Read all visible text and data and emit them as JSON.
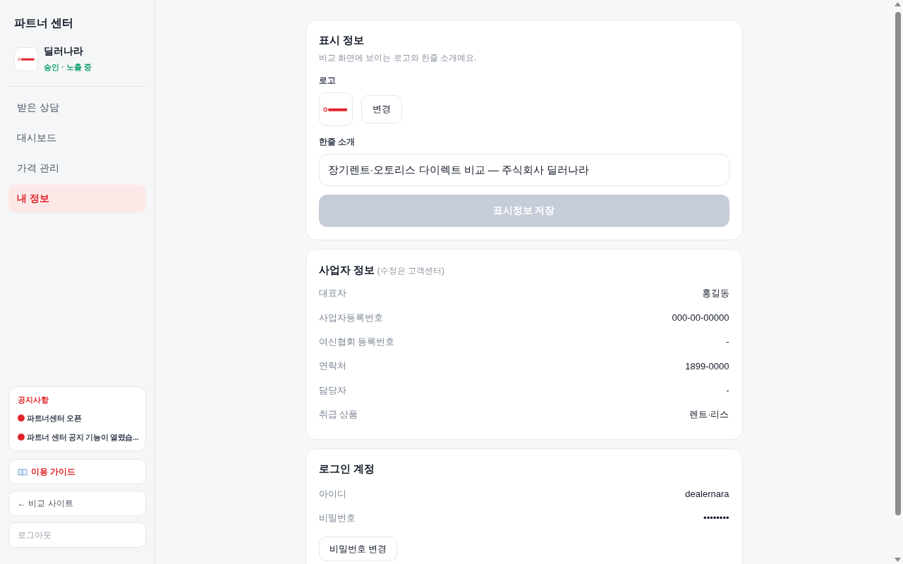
{
  "sidebar": {
    "title": "파트너 센터",
    "partner": {
      "name": "딜러나라",
      "status": "승인 · 노출 중"
    },
    "nav_items": [
      {
        "label": "받은 상담",
        "selected": false
      },
      {
        "label": "대시보드",
        "selected": false
      },
      {
        "label": "가격 관리",
        "selected": false
      },
      {
        "label": "내 정보",
        "selected": true
      }
    ],
    "notices": {
      "title": "공지사항",
      "items": [
        "파트너센터 오픈",
        "파트너 센터 공지 기능이 열렸습..."
      ]
    },
    "links": [
      {
        "kind": "guide",
        "label": "이용 가이드"
      },
      {
        "kind": "back",
        "label": "← 비교 사이트"
      },
      {
        "kind": "logout",
        "label": "로그아웃"
      }
    ]
  },
  "display_info": {
    "title": "표시 정보",
    "description": "비교 화면에 보이는 로고와 한줄 소개예요.",
    "logo_label": "로고",
    "change_button": "변경",
    "tagline_label": "한줄 소개",
    "tagline_value": "장기렌트·오토리스 다이렉트 비교 — 주식회사 딜러나라",
    "save_button": {
      "label": "표시정보 저장",
      "disabled": true
    }
  },
  "business_info": {
    "title": "사업자 정보",
    "note": "(수정은 고객센터)",
    "rows": [
      {
        "label": "대표자",
        "value": "홍길동"
      },
      {
        "label": "사업자등록번호",
        "value": "000-00-00000"
      },
      {
        "label": "여신협회 등록번호",
        "value": "-"
      },
      {
        "label": "연락처",
        "value": "1899-0000"
      },
      {
        "label": "담당자",
        "value": "-"
      },
      {
        "label": "취급 상품",
        "value": "렌트·리스"
      }
    ]
  },
  "login_account": {
    "title": "로그인 계정",
    "rows": [
      {
        "label": "아이디",
        "value": "dealernara"
      },
      {
        "label": "비밀번호",
        "value": "••••••••"
      }
    ],
    "change_password_button": "비밀번호 변경"
  }
}
